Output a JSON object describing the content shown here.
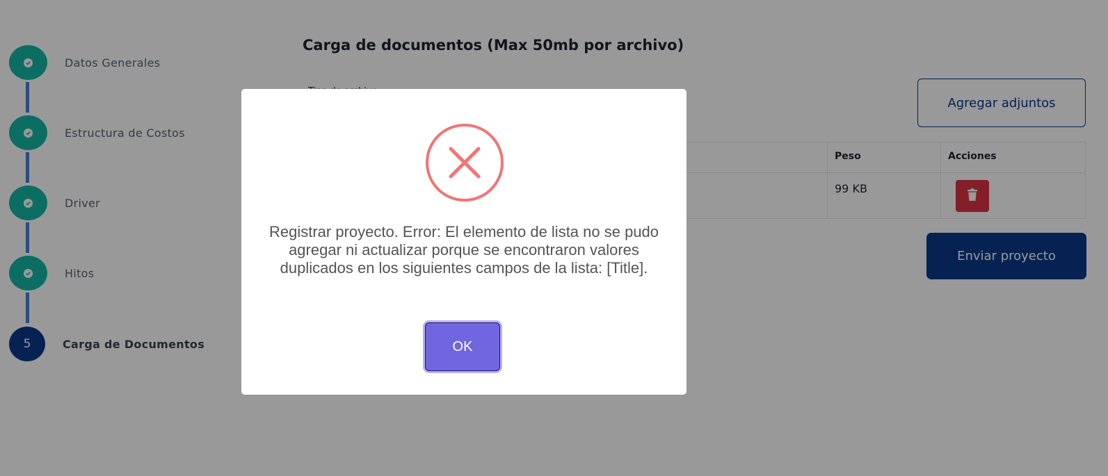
{
  "stepper": {
    "steps": [
      {
        "label": "Datos Generales",
        "state": "completed",
        "icon": "check-icon"
      },
      {
        "label": "Estructura de Costos",
        "state": "completed",
        "icon": "check-icon"
      },
      {
        "label": "Driver",
        "state": "completed",
        "icon": "check-icon"
      },
      {
        "label": "Hitos",
        "state": "completed",
        "icon": "check-icon"
      },
      {
        "label": "Carga de Documentos",
        "state": "current",
        "number": "5"
      }
    ]
  },
  "card": {
    "title": "Carga de documentos (Max 50mb por archivo)",
    "field_label": "Tipo de archivo",
    "add_button": "Agregar adjuntos",
    "table": {
      "headers": [
        "Peso",
        "Acciones"
      ],
      "rows": [
        {
          "size": "99 KB",
          "action_icon": "trash-icon"
        }
      ]
    },
    "submit_button": "Enviar proyecto"
  },
  "modal": {
    "icon": "error-x-icon",
    "message": "Registrar proyecto. Error: El elemento de lista no se pudo agregar ni actualizar porque se encontraron valores duplicados en los siguientes campos de la lista: [Title].",
    "ok_button": "OK"
  },
  "colors": {
    "step_completed": "#14b8a6",
    "step_current": "#0b3a8a",
    "connector": "#4a7fd4",
    "primary": "#0b3a8a",
    "danger": "#dc3545",
    "error_icon": "#f27474",
    "ok_button": "#7066e0"
  }
}
